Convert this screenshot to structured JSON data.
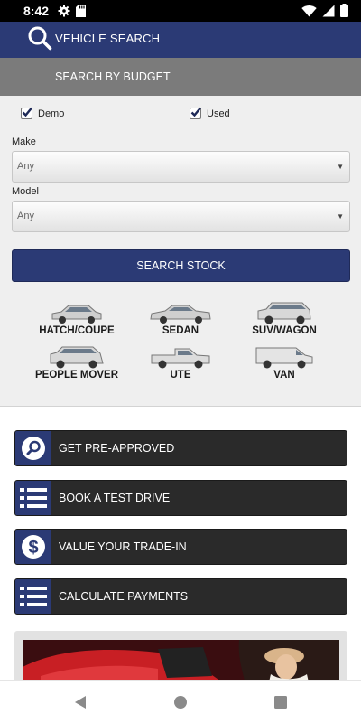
{
  "status_bar": {
    "time": "8:42",
    "left_icons": [
      "gear-icon",
      "sd-card-icon"
    ],
    "right_icons": [
      "wifi-icon",
      "signal-icon",
      "battery-icon"
    ]
  },
  "header": {
    "title": "VEHICLE SEARCH",
    "icon": "search-icon"
  },
  "budget": {
    "label": "SEARCH BY BUDGET"
  },
  "filters": {
    "demo": {
      "label": "Demo",
      "checked": true
    },
    "used": {
      "label": "Used",
      "checked": true
    },
    "make": {
      "label": "Make",
      "value": "Any"
    },
    "model": {
      "label": "Model",
      "value": "Any"
    },
    "search_button": "SEARCH STOCK"
  },
  "car_types": [
    {
      "label": "HATCH/COUPE",
      "color": "#cfcfcf"
    },
    {
      "label": "SEDAN",
      "color": "#cfcfcf"
    },
    {
      "label": "SUV/WAGON",
      "color": "#d8d8d8"
    },
    {
      "label": "PEOPLE MOVER",
      "color": "#d8d8d8"
    },
    {
      "label": "UTE",
      "color": "#dcdcdc"
    },
    {
      "label": "VAN",
      "color": "#e4e4e4"
    }
  ],
  "actions": [
    {
      "label": "GET PRE-APPROVED",
      "icon": "magnifier-icon"
    },
    {
      "label": "BOOK A TEST DRIVE",
      "icon": "list-icon"
    },
    {
      "label": "VALUE YOUR TRADE-IN",
      "icon": "dollar-icon"
    },
    {
      "label": "CALCULATE PAYMENTS",
      "icon": "list-icon"
    }
  ],
  "nav": [
    "back-icon",
    "home-icon",
    "recents-icon"
  ],
  "colors": {
    "brand_blue": "#2b3a75",
    "dark_button": "#2a2a2a",
    "grey_bar": "#7b7b7b",
    "panel": "#efefef"
  }
}
